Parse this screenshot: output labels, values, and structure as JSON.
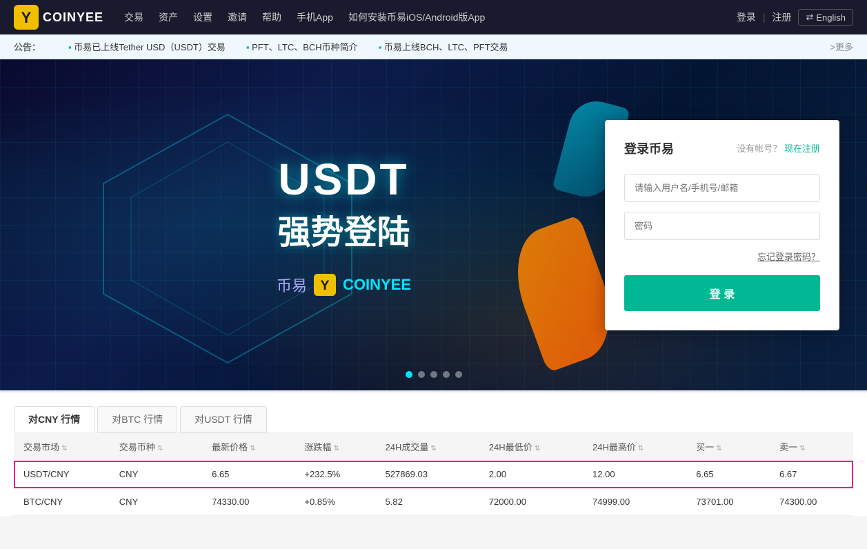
{
  "brand": {
    "logo_text": "COINYEE",
    "logo_icon": "Y"
  },
  "navbar": {
    "links": [
      {
        "label": "交易",
        "id": "trade"
      },
      {
        "label": "资产",
        "id": "assets"
      },
      {
        "label": "设置",
        "id": "settings"
      },
      {
        "label": "邀请",
        "id": "invite"
      },
      {
        "label": "帮助",
        "id": "help"
      },
      {
        "label": "手机App",
        "id": "mobile-app"
      },
      {
        "label": "如何安装币易iOS/Android版App",
        "id": "install-app"
      }
    ],
    "login_label": "登录",
    "register_label": "注册",
    "lang_label": "English",
    "lang_icon": "⇄"
  },
  "announcement": {
    "prefix": "公告：",
    "items": [
      "币易已上线Tether USD（USDT）交易",
      "PFT、LTC、BCH币种简介",
      "币易上线BCH、LTC、PFT交易"
    ],
    "more": ">更多"
  },
  "hero": {
    "usdt_text": "USDT",
    "subtitle": "强势登陆",
    "brand_prefix": "币易",
    "brand_name": "COINYEE",
    "carousel_dots": [
      true,
      false,
      false,
      false,
      false
    ]
  },
  "login": {
    "title": "登录币易",
    "no_account": "没有帐号？",
    "register_now": "现在注册",
    "username_placeholder": "请输入用户名/手机号/邮箱",
    "password_placeholder": "密码",
    "forgot_label": "忘记登录密码？",
    "login_btn": "登 录"
  },
  "market": {
    "tabs": [
      {
        "label": "对CNY 行情",
        "active": true
      },
      {
        "label": "对BTC 行情",
        "active": false
      },
      {
        "label": "对USDT 行情",
        "active": false
      }
    ],
    "columns": [
      "交易市场",
      "交易币种",
      "最新价格",
      "涨跌幅",
      "24H成交量",
      "24H最低价",
      "24H最高价",
      "买一",
      "卖一"
    ],
    "rows": [
      {
        "market": "USDT/CNY",
        "currency": "CNY",
        "price": "6.65",
        "change": "+232.5%",
        "change_positive": true,
        "volume": "527869.03",
        "low": "2.00",
        "high": "12.00",
        "buy": "6.65",
        "sell": "6.67",
        "highlighted": true
      },
      {
        "market": "BTC/CNY",
        "currency": "CNY",
        "price": "74330.00",
        "change": "+0.85%",
        "change_positive": true,
        "volume": "5.82",
        "low": "72000.00",
        "high": "74999.00",
        "buy": "73701.00",
        "sell": "74300.00",
        "highlighted": false
      }
    ]
  }
}
